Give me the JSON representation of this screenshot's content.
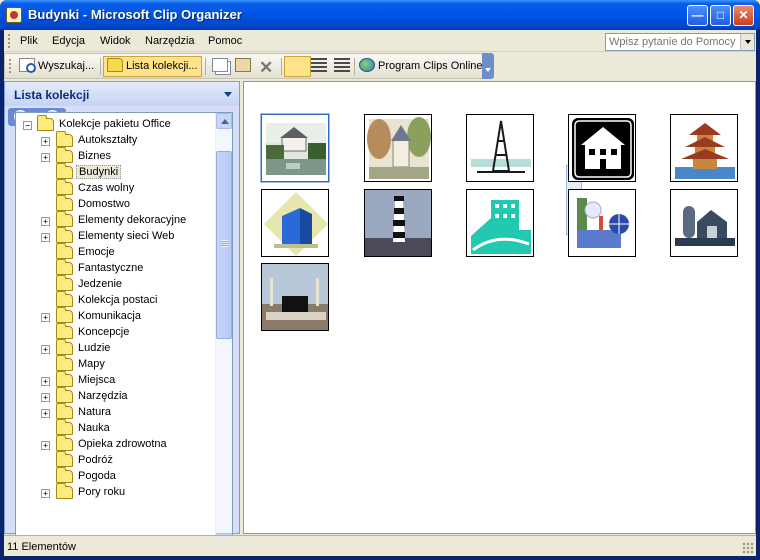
{
  "window": {
    "title": "Budynki - Microsoft Clip Organizer"
  },
  "menu": [
    "Plik",
    "Edycja",
    "Widok",
    "Narzędzia",
    "Pomoc"
  ],
  "help_search": {
    "placeholder": "Wpisz pytanie do Pomocy"
  },
  "toolbar": {
    "search_label": "Wyszukaj...",
    "collection_list_label": "Lista kolekcji...",
    "online_label": "Program Clips Online"
  },
  "task_pane": {
    "title": "Lista kolekcji"
  },
  "tree": {
    "root": "Kolekcje pakietu Office",
    "items": [
      {
        "label": "Autokształty",
        "expandable": true
      },
      {
        "label": "Biznes",
        "expandable": true
      },
      {
        "label": "Budynki",
        "expandable": false,
        "selected": true
      },
      {
        "label": "Czas wolny",
        "expandable": false
      },
      {
        "label": "Domostwo",
        "expandable": false
      },
      {
        "label": "Elementy dekoracyjne",
        "expandable": true
      },
      {
        "label": "Elementy sieci Web",
        "expandable": true
      },
      {
        "label": "Emocje",
        "expandable": false
      },
      {
        "label": "Fantastyczne",
        "expandable": false
      },
      {
        "label": "Jedzenie",
        "expandable": false
      },
      {
        "label": "Kolekcja postaci",
        "expandable": false
      },
      {
        "label": "Komunikacja",
        "expandable": true
      },
      {
        "label": "Koncepcje",
        "expandable": false
      },
      {
        "label": "Ludzie",
        "expandable": true
      },
      {
        "label": "Mapy",
        "expandable": false
      },
      {
        "label": "Miejsca",
        "expandable": true
      },
      {
        "label": "Narzędzia",
        "expandable": true
      },
      {
        "label": "Natura",
        "expandable": true
      },
      {
        "label": "Nauka",
        "expandable": false
      },
      {
        "label": "Opieka zdrowotna",
        "expandable": true
      },
      {
        "label": "Podróż",
        "expandable": false
      },
      {
        "label": "Pogoda",
        "expandable": false
      },
      {
        "label": "Pory roku",
        "expandable": true
      }
    ]
  },
  "clips": [
    {
      "name": "house-by-pond-clip"
    },
    {
      "name": "church-in-trees-clip"
    },
    {
      "name": "eiffel-tower-clip"
    },
    {
      "name": "house-silhouette-clip"
    },
    {
      "name": "pagoda-clip"
    },
    {
      "name": "blue-office-building-clip"
    },
    {
      "name": "lighthouse-clip"
    },
    {
      "name": "teal-building-clip"
    },
    {
      "name": "factory-globe-clip"
    },
    {
      "name": "barn-silo-clip"
    },
    {
      "name": "mosque-clip"
    }
  ],
  "status": {
    "text": "11 Elementów"
  }
}
